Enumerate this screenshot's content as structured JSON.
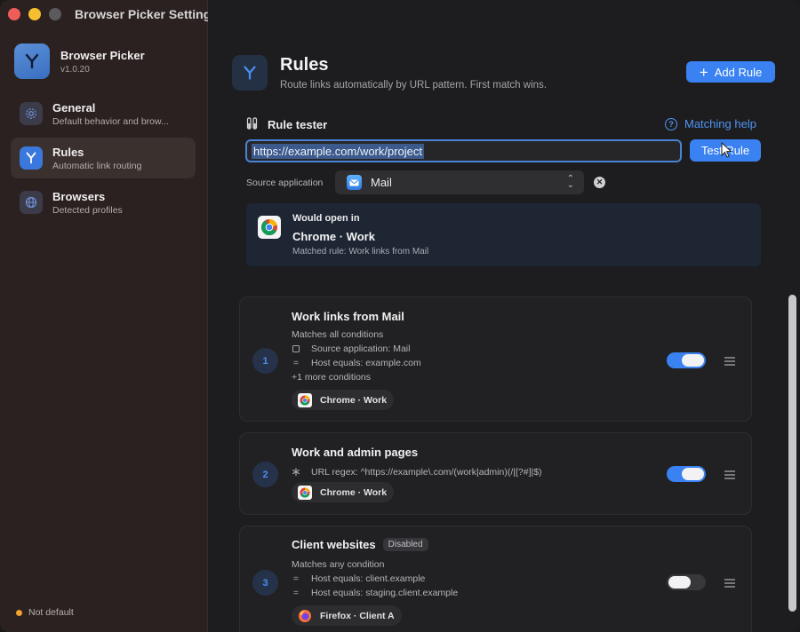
{
  "window": {
    "title": "Browser Picker Settings"
  },
  "app": {
    "name": "Browser Picker",
    "version": "v1.0.20"
  },
  "sidebar": {
    "items": [
      {
        "label": "General",
        "sub": "Default behavior and brow..."
      },
      {
        "label": "Rules",
        "sub": "Automatic link routing"
      },
      {
        "label": "Browsers",
        "sub": "Detected profiles"
      }
    ],
    "status": "Not default"
  },
  "page": {
    "title": "Rules",
    "subtitle": "Route links automatically by URL pattern. First match wins.",
    "add_rule_label": "Add Rule"
  },
  "tester": {
    "label": "Rule tester",
    "help_label": "Matching help",
    "url_value": "https://example.com/work/project",
    "test_button": "Test Rule",
    "source_label": "Source application",
    "source_value": "Mail",
    "result": {
      "heading": "Would open in",
      "browser": "Chrome · Work",
      "matched": "Matched rule: Work links from Mail"
    }
  },
  "rules": [
    {
      "number": "1",
      "title": "Work links from Mail",
      "mode": "Matches all conditions",
      "conditions": [
        "Source application: Mail",
        "Host equals: example.com"
      ],
      "more": "+1 more conditions",
      "target": "Chrome · Work",
      "enabled": true
    },
    {
      "number": "2",
      "title": "Work and admin pages",
      "conditions": [
        "URL regex: ^https://example\\.com/(work|admin)(/|[?#]|$)"
      ],
      "target": "Chrome · Work",
      "enabled": true
    },
    {
      "number": "3",
      "title": "Client websites",
      "badge": "Disabled",
      "mode": "Matches any condition",
      "conditions": [
        "Host equals: client.example",
        "Host equals: staging.client.example"
      ],
      "target": "Firefox · Client A",
      "enabled": false
    }
  ],
  "colors": {
    "accent": "#3a82f1",
    "sidebar_bg": "#2a2120",
    "main_bg": "#1d1d1f",
    "status_dot": "#f0a331"
  }
}
